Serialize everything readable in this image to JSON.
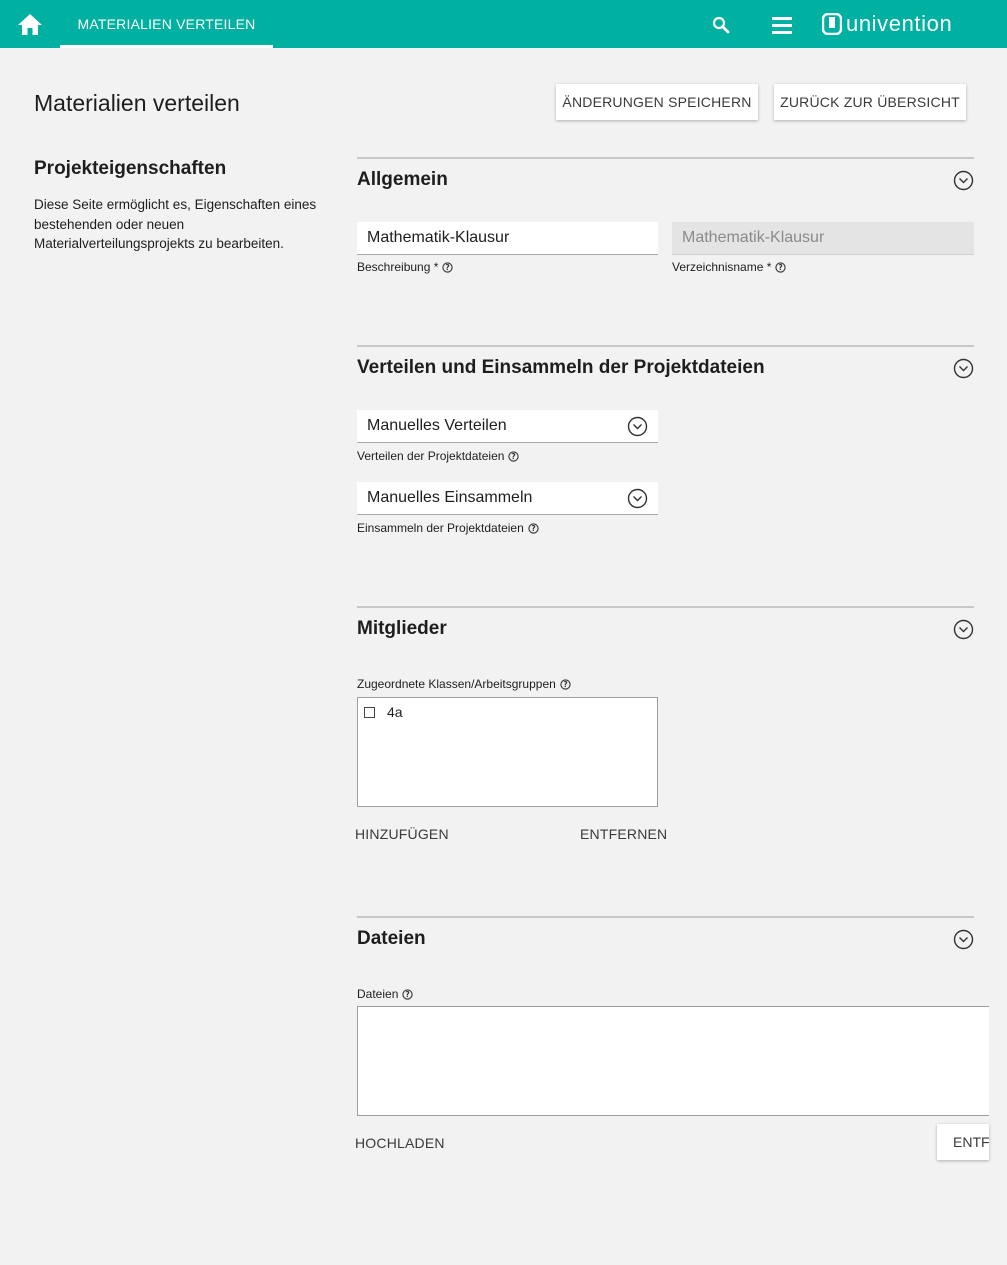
{
  "topbar": {
    "tab_label": "MATERIALIEN VERTEILEN",
    "logo_text": "univention",
    "color": "#00b0a0"
  },
  "header": {
    "title": "Materialien verteilen",
    "save_label": "ÄNDERUNGEN SPEICHERN",
    "back_label": "ZURÜCK ZUR ÜBERSICHT"
  },
  "left": {
    "title": "Projekteigenschaften",
    "description": "Diese Seite ermöglicht es, Eigenschaften eines bestehenden oder neuen Materialverteilungsprojekts zu bearbeiten."
  },
  "general": {
    "title": "Allgemein",
    "description_value": "Mathematik-Klausur",
    "description_label": "Beschreibung *",
    "dirname_value": "Mathematik-Klausur",
    "dirname_label": "Verzeichnisname *"
  },
  "distribution": {
    "title": "Verteilen und Einsammeln der Projektdateien",
    "distribute_value": "Manuelles Verteilen",
    "distribute_label": "Verteilen der Projektdateien",
    "collect_value": "Manuelles Einsammeln",
    "collect_label": "Einsammeln der Projektdateien"
  },
  "members": {
    "title": "Mitglieder",
    "list_label": "Zugeordnete Klassen/Arbeitsgruppen",
    "items": [
      "4a"
    ],
    "add_label": "HINZUFÜGEN",
    "remove_label": "ENTFERNEN"
  },
  "files": {
    "title": "Dateien",
    "list_label": "Dateien",
    "upload_label": "HOCHLADEN",
    "remove_label": "ENTFERNEN"
  }
}
